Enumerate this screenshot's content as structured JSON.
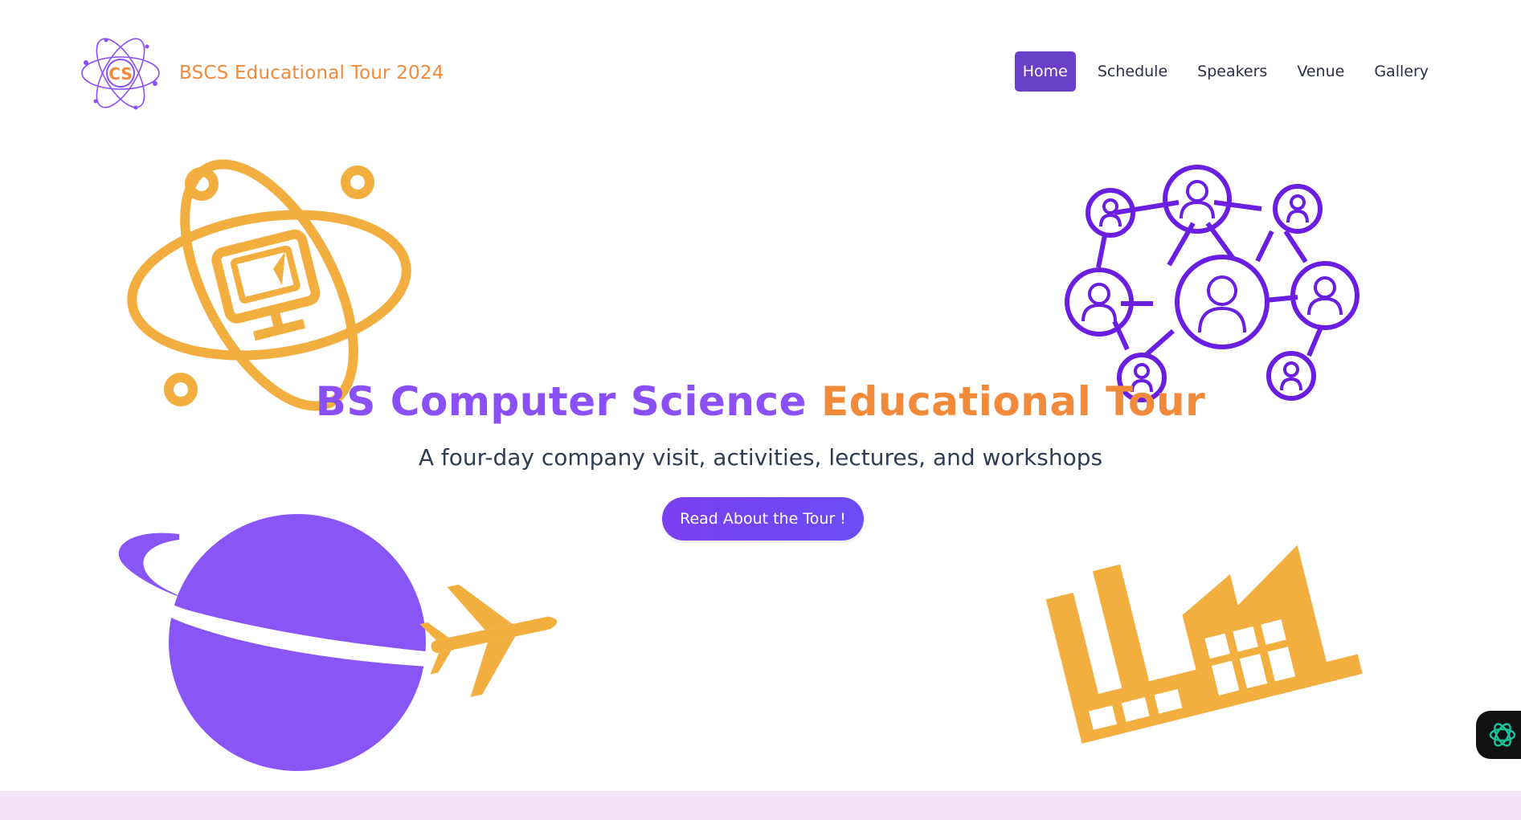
{
  "brand": {
    "logo_text": "CS",
    "title": "BSCS Educational Tour 2024",
    "logo_icon": "atom-logo-icon"
  },
  "nav": {
    "items": [
      {
        "label": "Home",
        "active": true
      },
      {
        "label": "Schedule",
        "active": false
      },
      {
        "label": "Speakers",
        "active": false
      },
      {
        "label": "Venue",
        "active": false
      },
      {
        "label": "Gallery",
        "active": false
      }
    ]
  },
  "hero": {
    "title_part_a": "BS Computer Science",
    "title_part_b": "Educational Tour",
    "subtitle": "A four-day company visit, activities, lectures, and workshops",
    "cta_label": "Read About the Tour !"
  },
  "illustrations": {
    "top_left": "atom-computer-icon",
    "top_right": "people-network-icon",
    "bottom_left": "planet-airplane-icon",
    "bottom_right": "factory-icon"
  },
  "widget": {
    "icon": "ai-assistant-icon"
  },
  "colors": {
    "orange": "#f28a3c",
    "purple": "#8a4ff5",
    "nav_active": "#6a3fc7",
    "illus_orange": "#f2ae3f",
    "illus_purple": "#6a1fe0",
    "footer_band": "#f3e5f7"
  }
}
